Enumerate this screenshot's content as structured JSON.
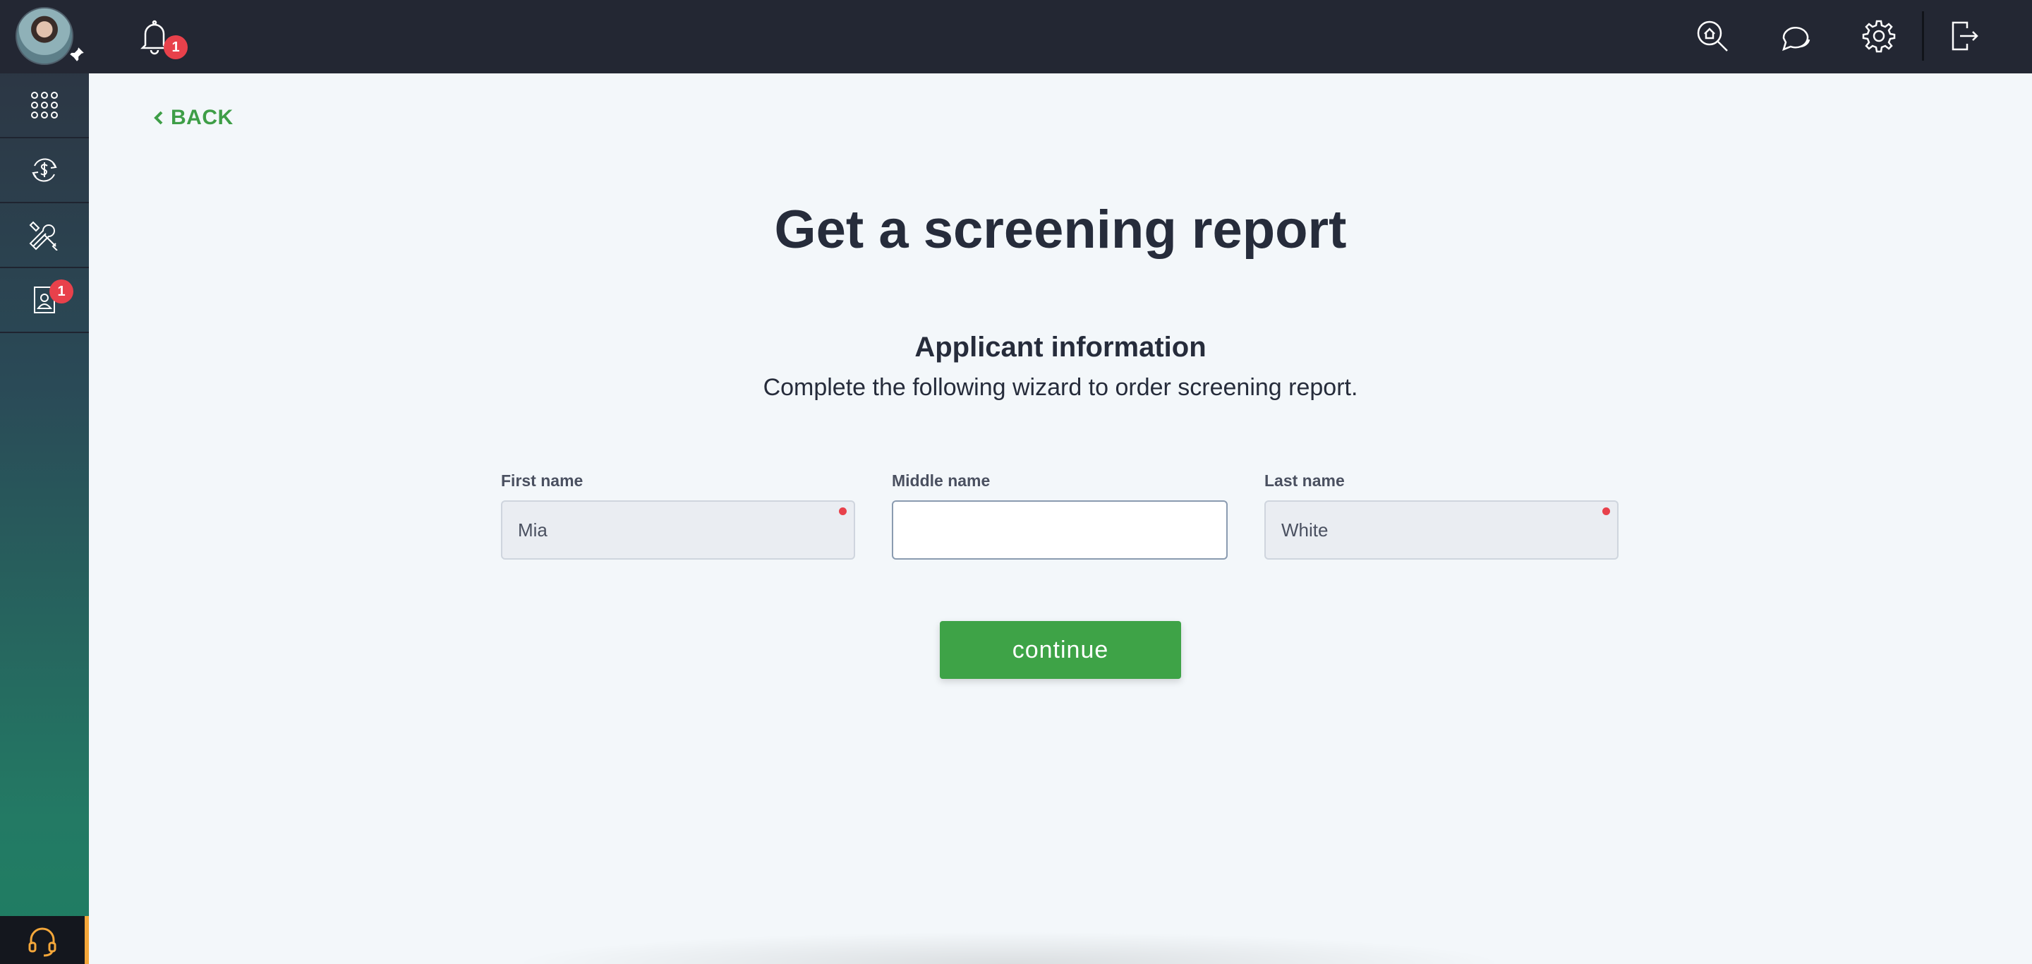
{
  "sidebar": {
    "items": [
      {
        "name": "apps",
        "icon": "grid-icon"
      },
      {
        "name": "payments",
        "icon": "dollar-cycle-icon"
      },
      {
        "name": "tools",
        "icon": "tools-icon"
      },
      {
        "name": "applicants",
        "icon": "contact-document-icon",
        "badge": "1"
      }
    ],
    "support_icon": "headset-icon"
  },
  "topbar": {
    "notifications_badge": "1",
    "icons": [
      "search-home-icon",
      "chat-icon",
      "gear-icon",
      "logout-icon"
    ]
  },
  "main": {
    "back_label": "BACK",
    "title": "Get a screening report",
    "section_title": "Applicant information",
    "section_subtitle": "Complete the following wizard to order screening report.",
    "fields": {
      "first_name": {
        "label": "First name",
        "value": "Mia"
      },
      "middle_name": {
        "label": "Middle name",
        "value": ""
      },
      "last_name": {
        "label": "Last name",
        "value": "White"
      }
    },
    "continue_label": "continue"
  },
  "colors": {
    "accent_green": "#3ea347",
    "badge_red": "#e8414b",
    "dark_bar": "#232733",
    "background": "#f3f7fa"
  }
}
